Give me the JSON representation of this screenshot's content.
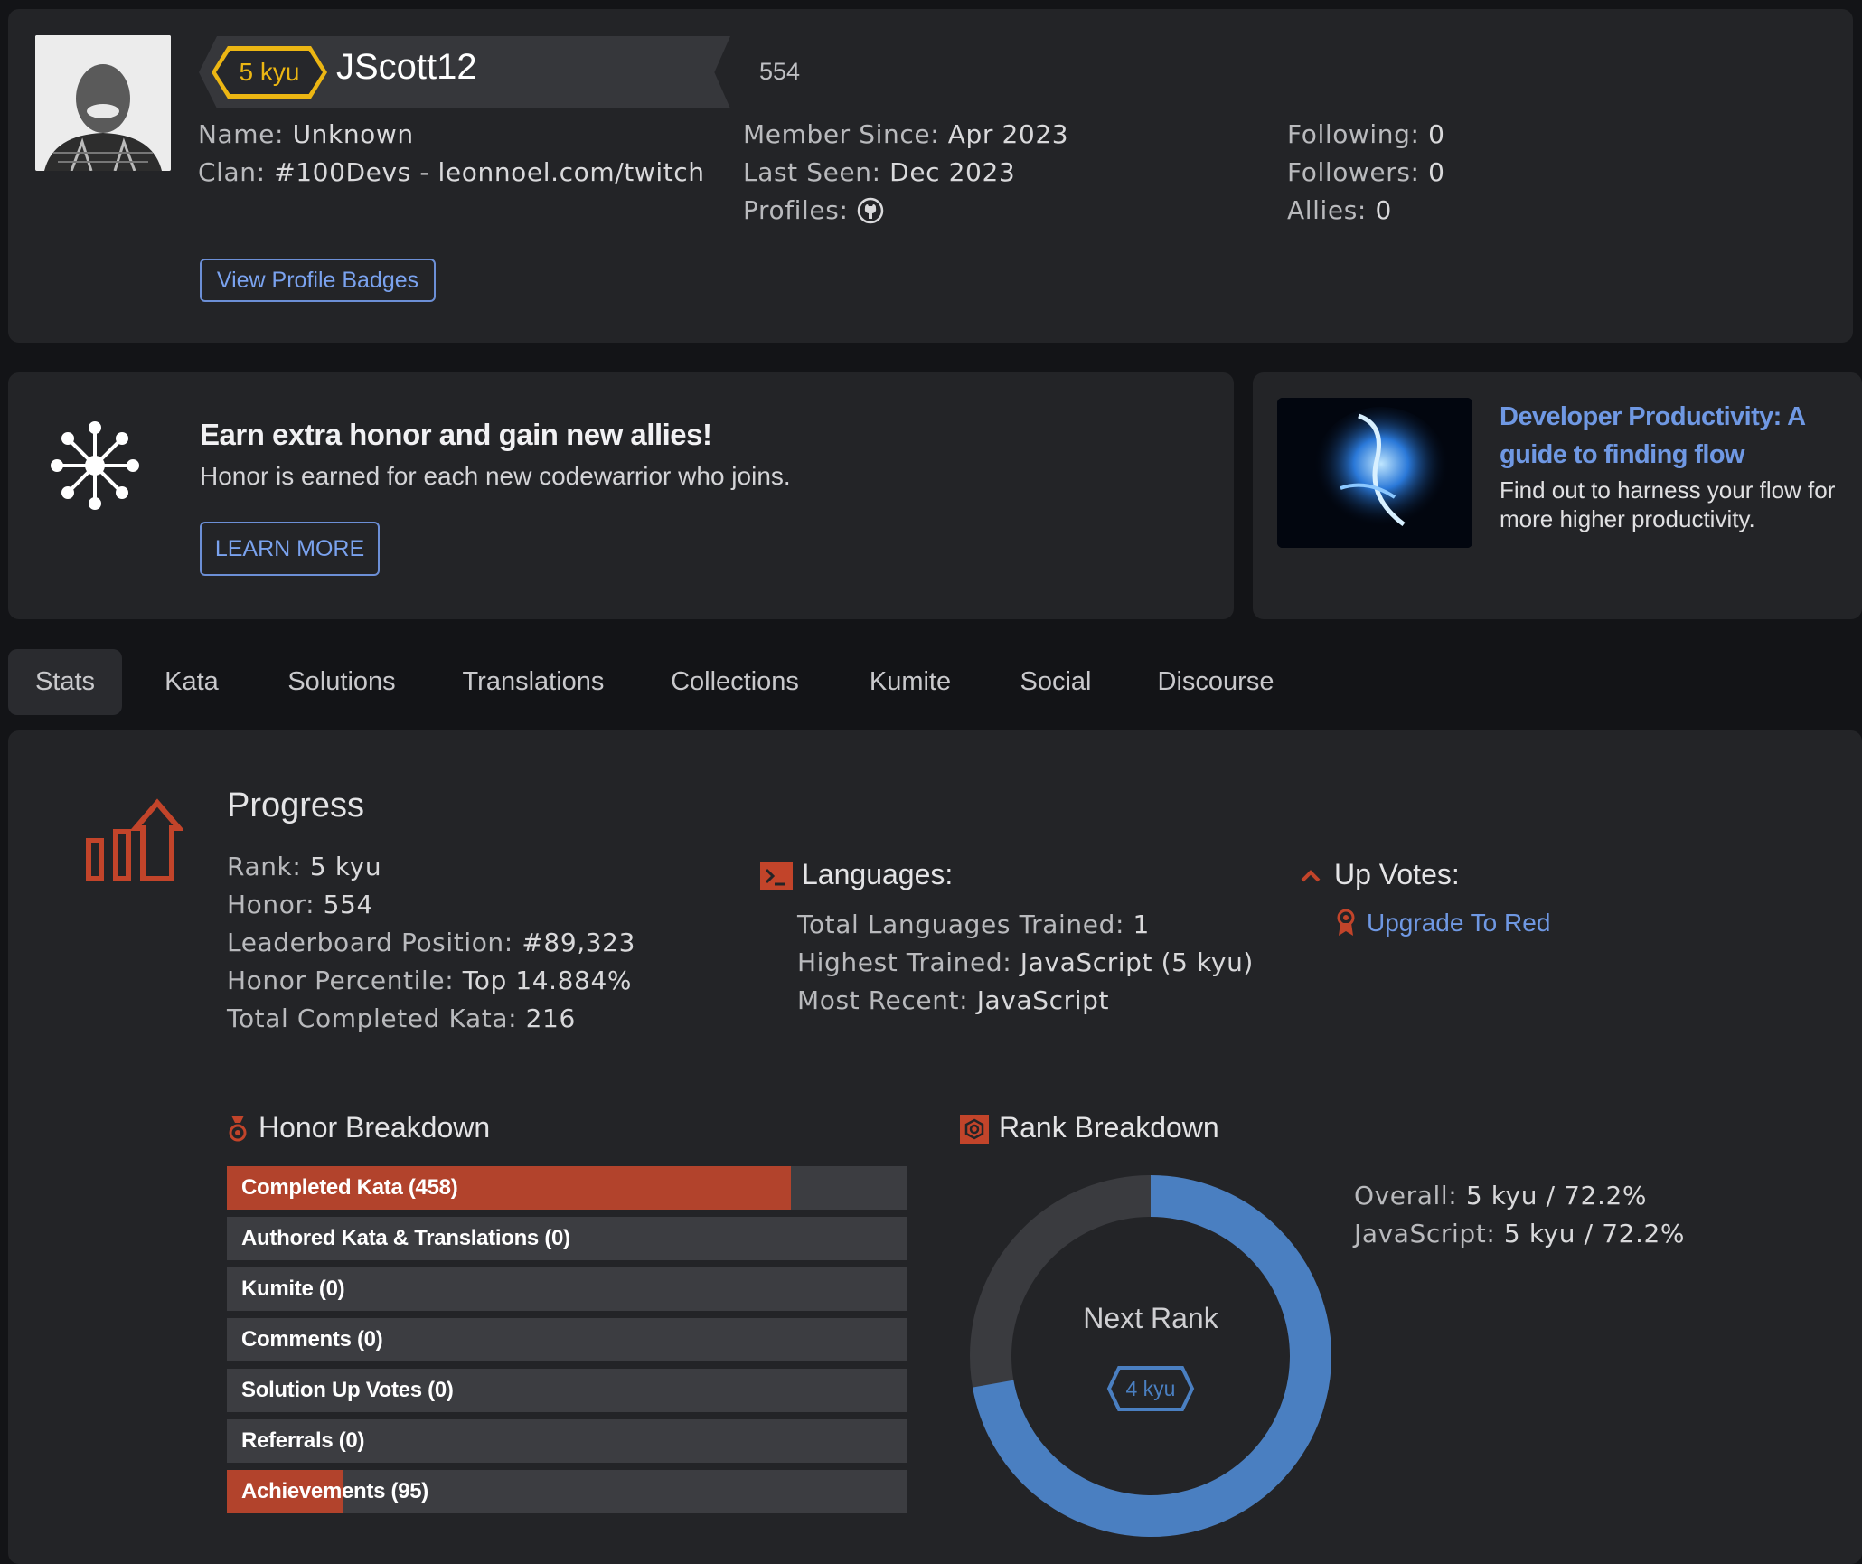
{
  "header": {
    "rank": "5 kyu",
    "username": "JScott12",
    "honor": "554",
    "name_label": "Name:",
    "name_value": "Unknown",
    "clan_label": "Clan:",
    "clan_value": "#100Devs - leonnoel.com/twitch",
    "member_since_label": "Member Since:",
    "member_since_value": "Apr 2023",
    "last_seen_label": "Last Seen:",
    "last_seen_value": "Dec 2023",
    "profiles_label": "Profiles:",
    "following_label": "Following:",
    "following_value": "0",
    "followers_label": "Followers:",
    "followers_value": "0",
    "allies_label": "Allies:",
    "allies_value": "0",
    "badges_button": "View Profile Badges",
    "profiles_icon": "github-icon"
  },
  "promo": {
    "title": "Earn extra honor and gain new allies!",
    "subtitle": "Honor is earned for each new codewarrior who joins.",
    "button": "LEARN MORE",
    "icon": "network-icon"
  },
  "article": {
    "title": "Developer Productivity: A guide to finding flow",
    "description": "Find out to harness your flow for more higher productivity."
  },
  "tabs": [
    "Stats",
    "Kata",
    "Solutions",
    "Translations",
    "Collections",
    "Kumite",
    "Social",
    "Discourse"
  ],
  "active_tab": "Stats",
  "progress": {
    "title": "Progress",
    "rank_label": "Rank:",
    "rank_value": "5 kyu",
    "honor_label": "Honor:",
    "honor_value": "554",
    "leaderboard_label": "Leaderboard Position:",
    "leaderboard_value": "#89,323",
    "percentile_label": "Honor Percentile:",
    "percentile_value": "Top 14.884%",
    "completed_label": "Total Completed Kata:",
    "completed_value": "216"
  },
  "languages": {
    "title": "Languages:",
    "trained_label": "Total Languages Trained:",
    "trained_value": "1",
    "highest_label": "Highest Trained:",
    "highest_value": "JavaScript (5 kyu)",
    "recent_label": "Most Recent:",
    "recent_value": "JavaScript"
  },
  "upvotes": {
    "title": "Up Votes:",
    "link": "Upgrade To Red"
  },
  "honor_breakdown": {
    "title": "Honor Breakdown",
    "bars": [
      {
        "label": "Completed Kata (458)",
        "fraction": 0.83
      },
      {
        "label": "Authored Kata & Translations (0)",
        "fraction": 0
      },
      {
        "label": "Kumite (0)",
        "fraction": 0
      },
      {
        "label": "Comments (0)",
        "fraction": 0
      },
      {
        "label": "Solution Up Votes (0)",
        "fraction": 0
      },
      {
        "label": "Referrals (0)",
        "fraction": 0
      },
      {
        "label": "Achievements (95)",
        "fraction": 0.17
      }
    ]
  },
  "rank_breakdown": {
    "title": "Rank Breakdown",
    "center_label": "Next Rank",
    "next_rank": "4 kyu",
    "progress_fraction": 0.722,
    "overall_label": "Overall:",
    "overall_value": "5 kyu / 72.2%",
    "js_label": "JavaScript:",
    "js_value": "5 kyu / 72.2%"
  },
  "colors": {
    "accent_red": "#b2432c",
    "rank_yellow": "#ecb613",
    "link_blue": "#6f98e3",
    "donut_blue": "#4a7fc1"
  }
}
